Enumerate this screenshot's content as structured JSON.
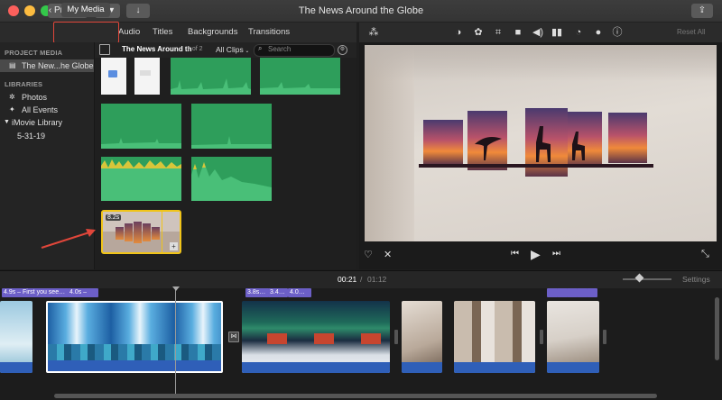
{
  "window": {
    "title": "The News Around the Globe",
    "projects_button": "Projects"
  },
  "tabs": [
    "My Media",
    "Audio",
    "Titles",
    "Backgrounds",
    "Transitions"
  ],
  "viewer_toolbar": {
    "icons": [
      "magic-wand-icon",
      "color-balance-icon",
      "color-palette-icon",
      "crop-icon",
      "camera-icon",
      "volume-icon",
      "equalizer-icon",
      "speedometer-icon",
      "filter-icon",
      "info-icon"
    ],
    "reset_all": "Reset All"
  },
  "sidebar": {
    "project_media_header": "PROJECT MEDIA",
    "project_item": "The New...he Globe",
    "libraries_header": "LIBRARIES",
    "items": [
      {
        "label": "Photos",
        "icon": "photos-icon"
      },
      {
        "label": "All Events",
        "icon": "star-icon"
      },
      {
        "label": "iMovie Library",
        "icon": "disclosure-triangle-icon"
      },
      {
        "label": "5-31-19",
        "icon": ""
      }
    ]
  },
  "browser": {
    "project_name": "The News Around th",
    "count": "1 of 2",
    "filter": "All Clips",
    "search_placeholder": "Search",
    "selected_clip_duration": "8.2s"
  },
  "timeline": {
    "current_time": "00:21",
    "separator": "/",
    "total_time": "01:12",
    "settings_label": "Settings",
    "title_chips": [
      "4.9s – First you see…",
      "4.0s –",
      "3.8s…",
      "3.4…",
      "4.0…",
      "",
      "",
      "",
      "",
      ""
    ]
  },
  "colors": {
    "accent_yellow": "#f0c419",
    "annotation_red": "#e0463a",
    "audio_clip_green": "#2e9e5b",
    "title_chip_purple": "#6c5fc7",
    "audio_strip_blue": "#2f5fb8"
  }
}
